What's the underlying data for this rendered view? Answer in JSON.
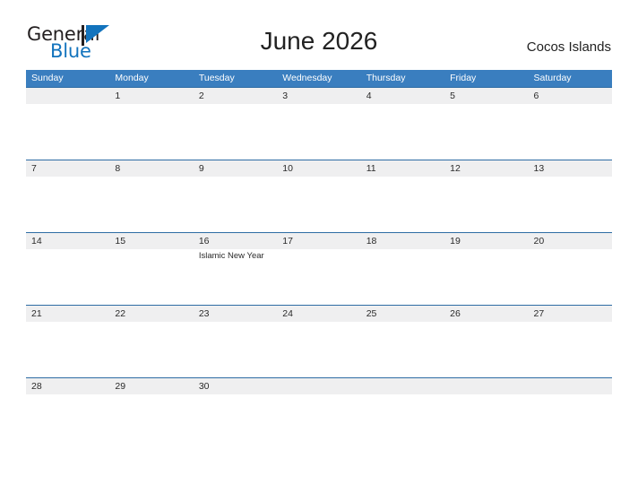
{
  "brand": {
    "name_part1": "General",
    "name_part2": "Blue",
    "flag_icon": "flag-triangle-icon",
    "accent_color": "#1273bd"
  },
  "header": {
    "title": "June 2026",
    "location": "Cocos Islands"
  },
  "calendar": {
    "header_bg": "#3a7ebf",
    "band_bg": "#efeff0",
    "band_border": "#2e6ca4",
    "weekdays": [
      "Sunday",
      "Monday",
      "Tuesday",
      "Wednesday",
      "Thursday",
      "Friday",
      "Saturday"
    ],
    "weeks": [
      {
        "days": [
          {
            "date": "",
            "event": ""
          },
          {
            "date": "1",
            "event": ""
          },
          {
            "date": "2",
            "event": ""
          },
          {
            "date": "3",
            "event": ""
          },
          {
            "date": "4",
            "event": ""
          },
          {
            "date": "5",
            "event": ""
          },
          {
            "date": "6",
            "event": ""
          }
        ]
      },
      {
        "days": [
          {
            "date": "7",
            "event": ""
          },
          {
            "date": "8",
            "event": ""
          },
          {
            "date": "9",
            "event": ""
          },
          {
            "date": "10",
            "event": ""
          },
          {
            "date": "11",
            "event": ""
          },
          {
            "date": "12",
            "event": ""
          },
          {
            "date": "13",
            "event": ""
          }
        ]
      },
      {
        "days": [
          {
            "date": "14",
            "event": ""
          },
          {
            "date": "15",
            "event": ""
          },
          {
            "date": "16",
            "event": "Islamic New Year"
          },
          {
            "date": "17",
            "event": ""
          },
          {
            "date": "18",
            "event": ""
          },
          {
            "date": "19",
            "event": ""
          },
          {
            "date": "20",
            "event": ""
          }
        ]
      },
      {
        "days": [
          {
            "date": "21",
            "event": ""
          },
          {
            "date": "22",
            "event": ""
          },
          {
            "date": "23",
            "event": ""
          },
          {
            "date": "24",
            "event": ""
          },
          {
            "date": "25",
            "event": ""
          },
          {
            "date": "26",
            "event": ""
          },
          {
            "date": "27",
            "event": ""
          }
        ]
      },
      {
        "days": [
          {
            "date": "28",
            "event": ""
          },
          {
            "date": "29",
            "event": ""
          },
          {
            "date": "30",
            "event": ""
          },
          {
            "date": "",
            "event": ""
          },
          {
            "date": "",
            "event": ""
          },
          {
            "date": "",
            "event": ""
          },
          {
            "date": "",
            "event": ""
          }
        ]
      }
    ]
  }
}
